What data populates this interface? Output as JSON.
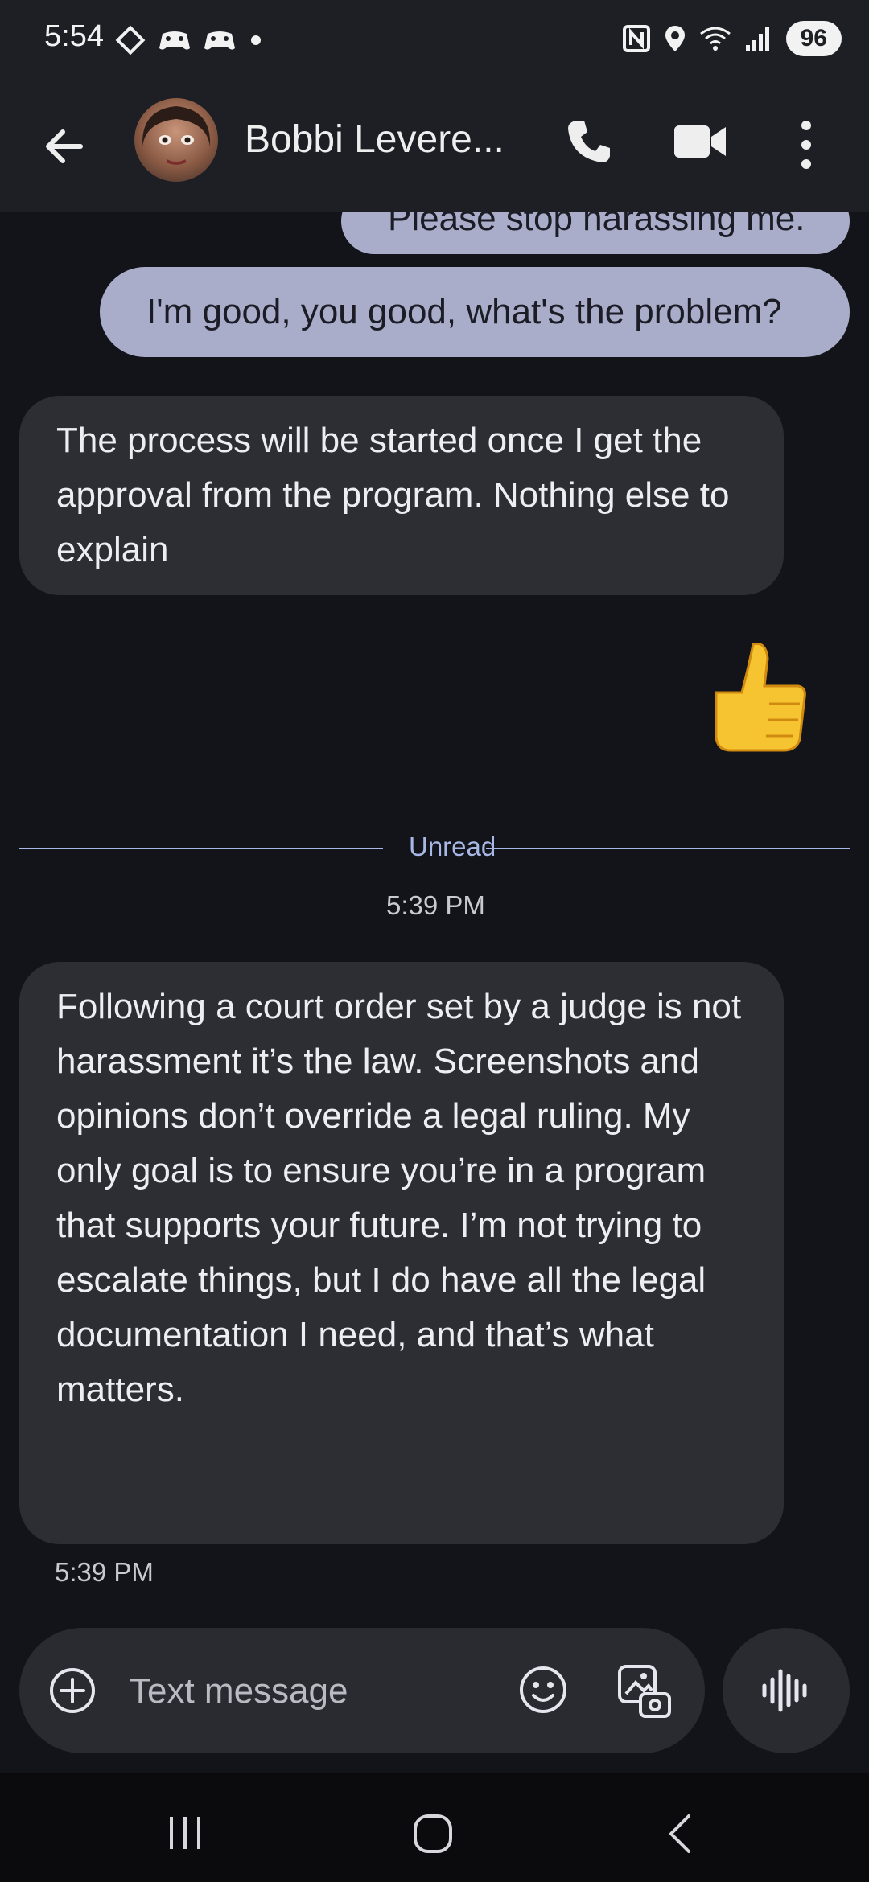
{
  "status_bar": {
    "time": "5:54",
    "left_icons": [
      "dot-diamond-icon",
      "gamepad-icon",
      "gamepad-icon",
      "notification-dot-icon"
    ],
    "right_icons": [
      "nfc-icon",
      "location-icon",
      "wifi-6-icon",
      "signal-icon"
    ],
    "battery": "96"
  },
  "header": {
    "contact_name": "Bobbi Levere..."
  },
  "messages": {
    "outgoing_partial": "Please stop harassing me.",
    "outgoing_1": "I'm good, you good, what's the problem?",
    "incoming_1": "The process will be started once I get the approval from the program.  Nothing else to explain",
    "reaction_emoji": "👍",
    "unread_label": "Unread",
    "unread_time": "5:39 PM",
    "incoming_2": "Following a court order set by a judge is not harassment it’s the law. Screenshots and opinions don’t override a legal ruling. My only goal is to ensure you’re in a program that supports your future. I’m not trying to escalate things, but I do have all the legal documentation I need, and that’s what matters.",
    "incoming_2_time": "5:39 PM"
  },
  "composer": {
    "placeholder": "Text message",
    "value": ""
  },
  "colors": {
    "background": "#131419",
    "bar": "#1d1f25",
    "outgoing_bubble": "#a9adc9",
    "incoming_bubble": "#2d2e34",
    "accent": "#a8b8e6"
  }
}
